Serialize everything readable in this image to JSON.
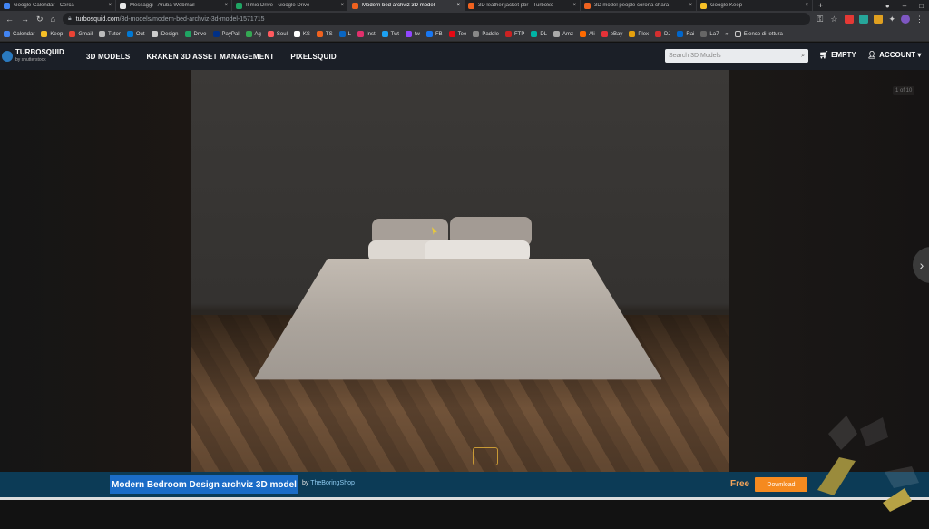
{
  "browser": {
    "tabs": [
      {
        "label": "Google Calendar - Cerca",
        "color": "#4285f4",
        "active": false
      },
      {
        "label": "Messaggi - Aruba Webmail",
        "color": "#e8e8e8",
        "active": false
      },
      {
        "label": "Il mio Drive - Google Drive",
        "color": "#1fa463",
        "active": false
      },
      {
        "label": "Modern bed archviz 3D model",
        "color": "#f0621f",
        "active": true
      },
      {
        "label": "3D leather jacket pbr - TurboSq",
        "color": "#f0621f",
        "active": false
      },
      {
        "label": "3D model people corona chara",
        "color": "#f0621f",
        "active": false
      },
      {
        "label": "Google Keep",
        "color": "#f6bf26",
        "active": false
      }
    ],
    "tab_close": "×",
    "new_tab": "+",
    "url_host": "turbosquid.com",
    "url_path": "/3d-models/modern-bed-archviz-3d-model-1571715",
    "bookmarks": [
      {
        "label": "Calendar",
        "color": "#4285f4"
      },
      {
        "label": "Keep",
        "color": "#f6bf26"
      },
      {
        "label": "Gmail",
        "color": "#ea4335"
      },
      {
        "label": "Tutor",
        "color": "#bbbbbb"
      },
      {
        "label": "Out",
        "color": "#0078d4"
      },
      {
        "label": "iDesign",
        "color": "#cccccc"
      },
      {
        "label": "Drive",
        "color": "#1fa463"
      },
      {
        "label": "PayPal",
        "color": "#003087"
      },
      {
        "label": "Ag",
        "color": "#34a853"
      },
      {
        "label": "Soul",
        "color": "#ff5a5f"
      },
      {
        "label": "KS",
        "color": "#ffffff"
      },
      {
        "label": "TS",
        "color": "#f0621f"
      },
      {
        "label": "L",
        "color": "#0a66c2"
      },
      {
        "label": "Inst",
        "color": "#e1306c"
      },
      {
        "label": "Twt",
        "color": "#1da1f2"
      },
      {
        "label": "tw",
        "color": "#9146ff"
      },
      {
        "label": "FB",
        "color": "#1877f2"
      },
      {
        "label": "Tee",
        "color": "#e50914"
      },
      {
        "label": "Paddle",
        "color": "#888888"
      },
      {
        "label": "FTP",
        "color": "#cc2222"
      },
      {
        "label": "DL",
        "color": "#00b3a4"
      },
      {
        "label": "Amz",
        "color": "#aaaaaa"
      },
      {
        "label": "Ali",
        "color": "#ff6a00"
      },
      {
        "label": "eBay",
        "color": "#e53238"
      },
      {
        "label": "Plex",
        "color": "#e5a00d"
      },
      {
        "label": "DJ",
        "color": "#d32f2f"
      },
      {
        "label": "Rai",
        "color": "#0066cc"
      },
      {
        "label": "La7",
        "color": "#666666"
      }
    ],
    "bookmarks_more": "»",
    "other_bookmarks": "Elenco di lettura"
  },
  "site": {
    "logo_title": "TURBOSQUID",
    "logo_sub": "by shutterstock",
    "nav": [
      "3D MODELS",
      "KRAKEN 3D ASSET MANAGEMENT",
      "PIXELSQUID"
    ],
    "search_placeholder": "Search 3D Models",
    "cart_label": "EMPTY",
    "account_label": "ACCOUNT ▾"
  },
  "viewer": {
    "counter": "1 of 10",
    "next_arrow": "›"
  },
  "product": {
    "title": "Modern Bedroom Design archviz 3D model",
    "by": "by",
    "author": "TheBoringShop",
    "price": "Free",
    "download_label": "Download"
  },
  "colors": {
    "site_nav_bg": "#1b1f27",
    "info_bar_bg": "#0c3b56",
    "selection": "#1b6cc7",
    "accent_orange": "#f58a1f"
  }
}
